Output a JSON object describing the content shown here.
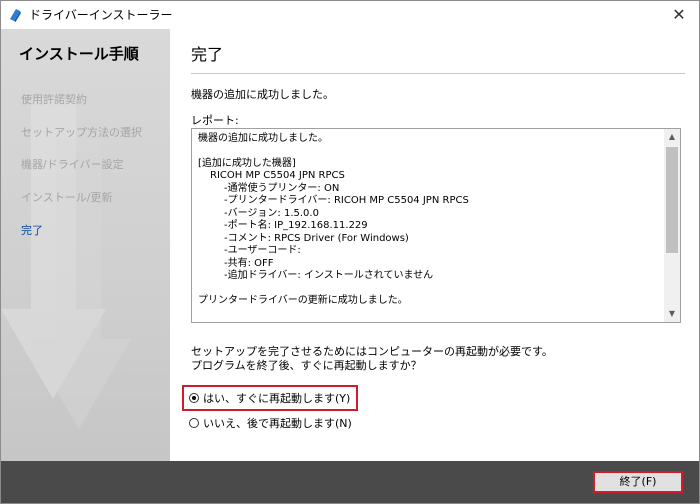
{
  "window": {
    "title": "ドライバーインストーラー",
    "close_glyph": "✕"
  },
  "sidebar": {
    "title": "インストール手順",
    "items": [
      {
        "label": "使用許諾契約"
      },
      {
        "label": "セットアップ方法の選択"
      },
      {
        "label": "機器/ドライバー設定"
      },
      {
        "label": "インストール/更新"
      },
      {
        "label": "完了"
      }
    ]
  },
  "main": {
    "title": "完了",
    "success_message": "機器の追加に成功しました。",
    "report_label": "レポート:",
    "report": {
      "line1": "機器の追加に成功しました。",
      "section": "[追加に成功した機器]",
      "device": "RICOH MP C5504 JPN RPCS",
      "details": [
        "-通常使うプリンター: ON",
        "-プリンタードライバー: RICOH MP C5504 JPN RPCS",
        "-バージョン: 1.5.0.0",
        "-ポート名: IP_192.168.11.229",
        "-コメント: RPCS Driver (For Windows)",
        "-ユーザーコード:",
        "-共有: OFF",
        "-追加ドライバー: インストールされていません"
      ],
      "final": "プリンタードライバーの更新に成功しました。"
    },
    "restart_note_1": "セットアップを完了させるためにはコンピューターの再起動が必要です。",
    "restart_note_2": "プログラムを終了後、すぐに再起動しますか？",
    "radio_yes": "はい、すぐに再起動します(Y)",
    "radio_no": "いいえ、後で再起動します(N)"
  },
  "footer": {
    "finish_label": "終了(F)"
  },
  "scroll": {
    "up": "▲",
    "down": "▼"
  },
  "colors": {
    "highlight": "#d21c2b",
    "active_step": "#0b4aa0",
    "footer_bg": "#4a4a4a"
  },
  "icons": {
    "app": "driver-installer-icon"
  }
}
